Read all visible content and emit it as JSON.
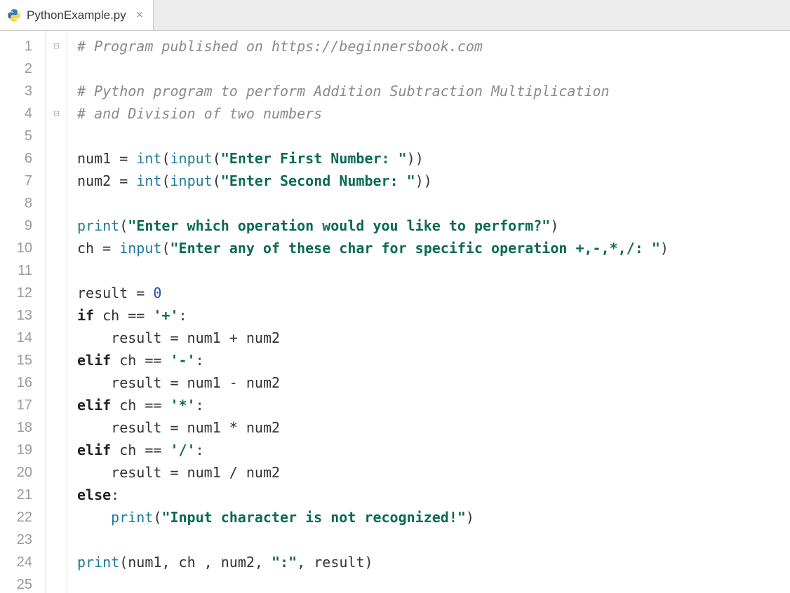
{
  "tab": {
    "filename": "PythonExample.py",
    "close_glyph": "×"
  },
  "gutter": {
    "start": 1,
    "end": 25
  },
  "fold_markers": {
    "1": "⊟",
    "4": "⊟"
  },
  "code": {
    "lines": [
      {
        "n": 1,
        "tokens": [
          {
            "cls": "tok-comment",
            "t": "# Program published on https://beginnersbook.com"
          }
        ]
      },
      {
        "n": 2,
        "tokens": []
      },
      {
        "n": 3,
        "tokens": [
          {
            "cls": "tok-comment",
            "t": "# Python program to perform Addition Subtraction Multiplication"
          }
        ]
      },
      {
        "n": 4,
        "tokens": [
          {
            "cls": "tok-comment",
            "t": "# and Division of two numbers"
          }
        ]
      },
      {
        "n": 5,
        "tokens": []
      },
      {
        "n": 6,
        "tokens": [
          {
            "cls": "tok-ident",
            "t": "num1 "
          },
          {
            "cls": "tok-op",
            "t": "= "
          },
          {
            "cls": "tok-builtin",
            "t": "int"
          },
          {
            "cls": "tok-op",
            "t": "("
          },
          {
            "cls": "tok-builtin",
            "t": "input"
          },
          {
            "cls": "tok-op",
            "t": "("
          },
          {
            "cls": "tok-string",
            "t": "\"Enter First Number: \""
          },
          {
            "cls": "tok-op",
            "t": "))"
          }
        ]
      },
      {
        "n": 7,
        "tokens": [
          {
            "cls": "tok-ident",
            "t": "num2 "
          },
          {
            "cls": "tok-op",
            "t": "= "
          },
          {
            "cls": "tok-builtin",
            "t": "int"
          },
          {
            "cls": "tok-op",
            "t": "("
          },
          {
            "cls": "tok-builtin",
            "t": "input"
          },
          {
            "cls": "tok-op",
            "t": "("
          },
          {
            "cls": "tok-string",
            "t": "\"Enter Second Number: \""
          },
          {
            "cls": "tok-op",
            "t": "))"
          }
        ]
      },
      {
        "n": 8,
        "tokens": []
      },
      {
        "n": 9,
        "tokens": [
          {
            "cls": "tok-builtin",
            "t": "print"
          },
          {
            "cls": "tok-op",
            "t": "("
          },
          {
            "cls": "tok-string",
            "t": "\"Enter which operation would you like to perform?\""
          },
          {
            "cls": "tok-op",
            "t": ")"
          }
        ]
      },
      {
        "n": 10,
        "tokens": [
          {
            "cls": "tok-ident",
            "t": "ch "
          },
          {
            "cls": "tok-op",
            "t": "= "
          },
          {
            "cls": "tok-builtin",
            "t": "input"
          },
          {
            "cls": "tok-op",
            "t": "("
          },
          {
            "cls": "tok-string",
            "t": "\"Enter any of these char for specific operation +,-,*,/: \""
          },
          {
            "cls": "tok-op",
            "t": ")"
          }
        ]
      },
      {
        "n": 11,
        "tokens": []
      },
      {
        "n": 12,
        "tokens": [
          {
            "cls": "tok-ident",
            "t": "result "
          },
          {
            "cls": "tok-op",
            "t": "= "
          },
          {
            "cls": "tok-number",
            "t": "0"
          }
        ]
      },
      {
        "n": 13,
        "tokens": [
          {
            "cls": "tok-keyword",
            "t": "if "
          },
          {
            "cls": "tok-ident",
            "t": "ch "
          },
          {
            "cls": "tok-op",
            "t": "== "
          },
          {
            "cls": "tok-string",
            "t": "'+'"
          },
          {
            "cls": "tok-op",
            "t": ":"
          }
        ]
      },
      {
        "n": 14,
        "tokens": [
          {
            "cls": "tok-ident",
            "t": "    result "
          },
          {
            "cls": "tok-op",
            "t": "= "
          },
          {
            "cls": "tok-ident",
            "t": "num1 "
          },
          {
            "cls": "tok-op",
            "t": "+ "
          },
          {
            "cls": "tok-ident",
            "t": "num2"
          }
        ]
      },
      {
        "n": 15,
        "tokens": [
          {
            "cls": "tok-keyword",
            "t": "elif "
          },
          {
            "cls": "tok-ident",
            "t": "ch "
          },
          {
            "cls": "tok-op",
            "t": "== "
          },
          {
            "cls": "tok-string",
            "t": "'-'"
          },
          {
            "cls": "tok-op",
            "t": ":"
          }
        ]
      },
      {
        "n": 16,
        "tokens": [
          {
            "cls": "tok-ident",
            "t": "    result "
          },
          {
            "cls": "tok-op",
            "t": "= "
          },
          {
            "cls": "tok-ident",
            "t": "num1 "
          },
          {
            "cls": "tok-op",
            "t": "- "
          },
          {
            "cls": "tok-ident",
            "t": "num2"
          }
        ]
      },
      {
        "n": 17,
        "tokens": [
          {
            "cls": "tok-keyword",
            "t": "elif "
          },
          {
            "cls": "tok-ident",
            "t": "ch "
          },
          {
            "cls": "tok-op",
            "t": "== "
          },
          {
            "cls": "tok-string",
            "t": "'*'"
          },
          {
            "cls": "tok-op",
            "t": ":"
          }
        ]
      },
      {
        "n": 18,
        "tokens": [
          {
            "cls": "tok-ident",
            "t": "    result "
          },
          {
            "cls": "tok-op",
            "t": "= "
          },
          {
            "cls": "tok-ident",
            "t": "num1 "
          },
          {
            "cls": "tok-op",
            "t": "* "
          },
          {
            "cls": "tok-ident",
            "t": "num2"
          }
        ]
      },
      {
        "n": 19,
        "tokens": [
          {
            "cls": "tok-keyword",
            "t": "elif "
          },
          {
            "cls": "tok-ident",
            "t": "ch "
          },
          {
            "cls": "tok-op",
            "t": "== "
          },
          {
            "cls": "tok-string",
            "t": "'/'"
          },
          {
            "cls": "tok-op",
            "t": ":"
          }
        ]
      },
      {
        "n": 20,
        "tokens": [
          {
            "cls": "tok-ident",
            "t": "    result "
          },
          {
            "cls": "tok-op",
            "t": "= "
          },
          {
            "cls": "tok-ident",
            "t": "num1 "
          },
          {
            "cls": "tok-op",
            "t": "/ "
          },
          {
            "cls": "tok-ident",
            "t": "num2"
          }
        ]
      },
      {
        "n": 21,
        "tokens": [
          {
            "cls": "tok-keyword",
            "t": "else"
          },
          {
            "cls": "tok-op",
            "t": ":"
          }
        ]
      },
      {
        "n": 22,
        "tokens": [
          {
            "cls": "tok-ident",
            "t": "    "
          },
          {
            "cls": "tok-builtin",
            "t": "print"
          },
          {
            "cls": "tok-op",
            "t": "("
          },
          {
            "cls": "tok-string",
            "t": "\"Input character is not recognized!\""
          },
          {
            "cls": "tok-op",
            "t": ")"
          }
        ]
      },
      {
        "n": 23,
        "tokens": []
      },
      {
        "n": 24,
        "tokens": [
          {
            "cls": "tok-builtin",
            "t": "print"
          },
          {
            "cls": "tok-op",
            "t": "("
          },
          {
            "cls": "tok-ident",
            "t": "num1"
          },
          {
            "cls": "tok-op",
            "t": ", "
          },
          {
            "cls": "tok-ident",
            "t": "ch "
          },
          {
            "cls": "tok-op",
            "t": ", "
          },
          {
            "cls": "tok-ident",
            "t": "num2"
          },
          {
            "cls": "tok-op",
            "t": ", "
          },
          {
            "cls": "tok-string",
            "t": "\":\""
          },
          {
            "cls": "tok-op",
            "t": ", "
          },
          {
            "cls": "tok-ident",
            "t": "result"
          },
          {
            "cls": "tok-op",
            "t": ")"
          }
        ]
      },
      {
        "n": 25,
        "tokens": []
      }
    ]
  }
}
